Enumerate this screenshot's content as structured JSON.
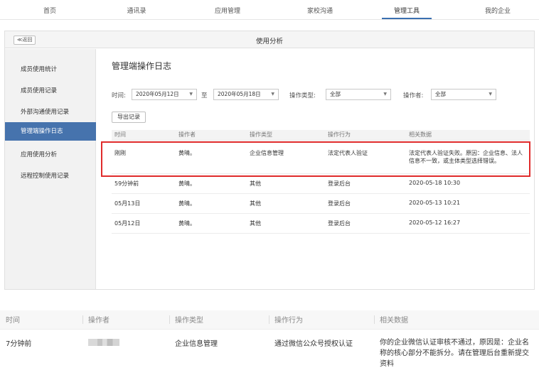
{
  "topnav": {
    "items": [
      "首页",
      "通讯录",
      "应用管理",
      "家校沟通",
      "管理工具",
      "我的企业"
    ],
    "active_index": 4
  },
  "panel": {
    "back_label": "≪返回",
    "title": "使用分析"
  },
  "sidebar": {
    "items": [
      "成员使用统计",
      "成员使用记录",
      "外部沟通使用记录",
      "管理端操作日志",
      "应用使用分析",
      "远程控制使用记录"
    ],
    "active_index": 3
  },
  "main": {
    "title": "管理端操作日志",
    "filters": {
      "time_label": "时间:",
      "start_date": "2020年05月12日",
      "to_label": "至",
      "end_date": "2020年05月18日",
      "type_label": "操作类型:",
      "type_value": "全部",
      "operator_label": "操作者:",
      "operator_value": "全部"
    },
    "export_label": "导出记录",
    "table": {
      "headers": [
        "时间",
        "操作者",
        "操作类型",
        "操作行为",
        "相关数据"
      ],
      "rows": [
        [
          "刚刚",
          "黄晴。",
          "企业信息管理",
          "法定代表人验证",
          "法定代表人验证失败。原因：企业信息、法人信息不一致，或主体类型选择错误。"
        ],
        [
          "59分钟前",
          "黄晴。",
          "其他",
          "登录后台",
          "2020-05-18 10:30"
        ],
        [
          "05月13日",
          "黄晴。",
          "其他",
          "登录后台",
          "2020-05-13 10:21"
        ],
        [
          "05月12日",
          "黄晴。",
          "其他",
          "登录后台",
          "2020-05-12 16:27"
        ]
      ]
    }
  },
  "detail": {
    "headers": [
      "时间",
      "操作者",
      "操作类型",
      "操作行为",
      "相关数据"
    ],
    "row": [
      "7分钟前",
      "",
      "企业信息管理",
      "通过微信公众号授权认证",
      "你的企业微信认证审核不通过，原因是：企业名称的核心部分不能拆分。请在管理后台重新提交资料"
    ]
  },
  "colors": {
    "accent": "#4673ad",
    "highlight": "#e02b2b"
  }
}
